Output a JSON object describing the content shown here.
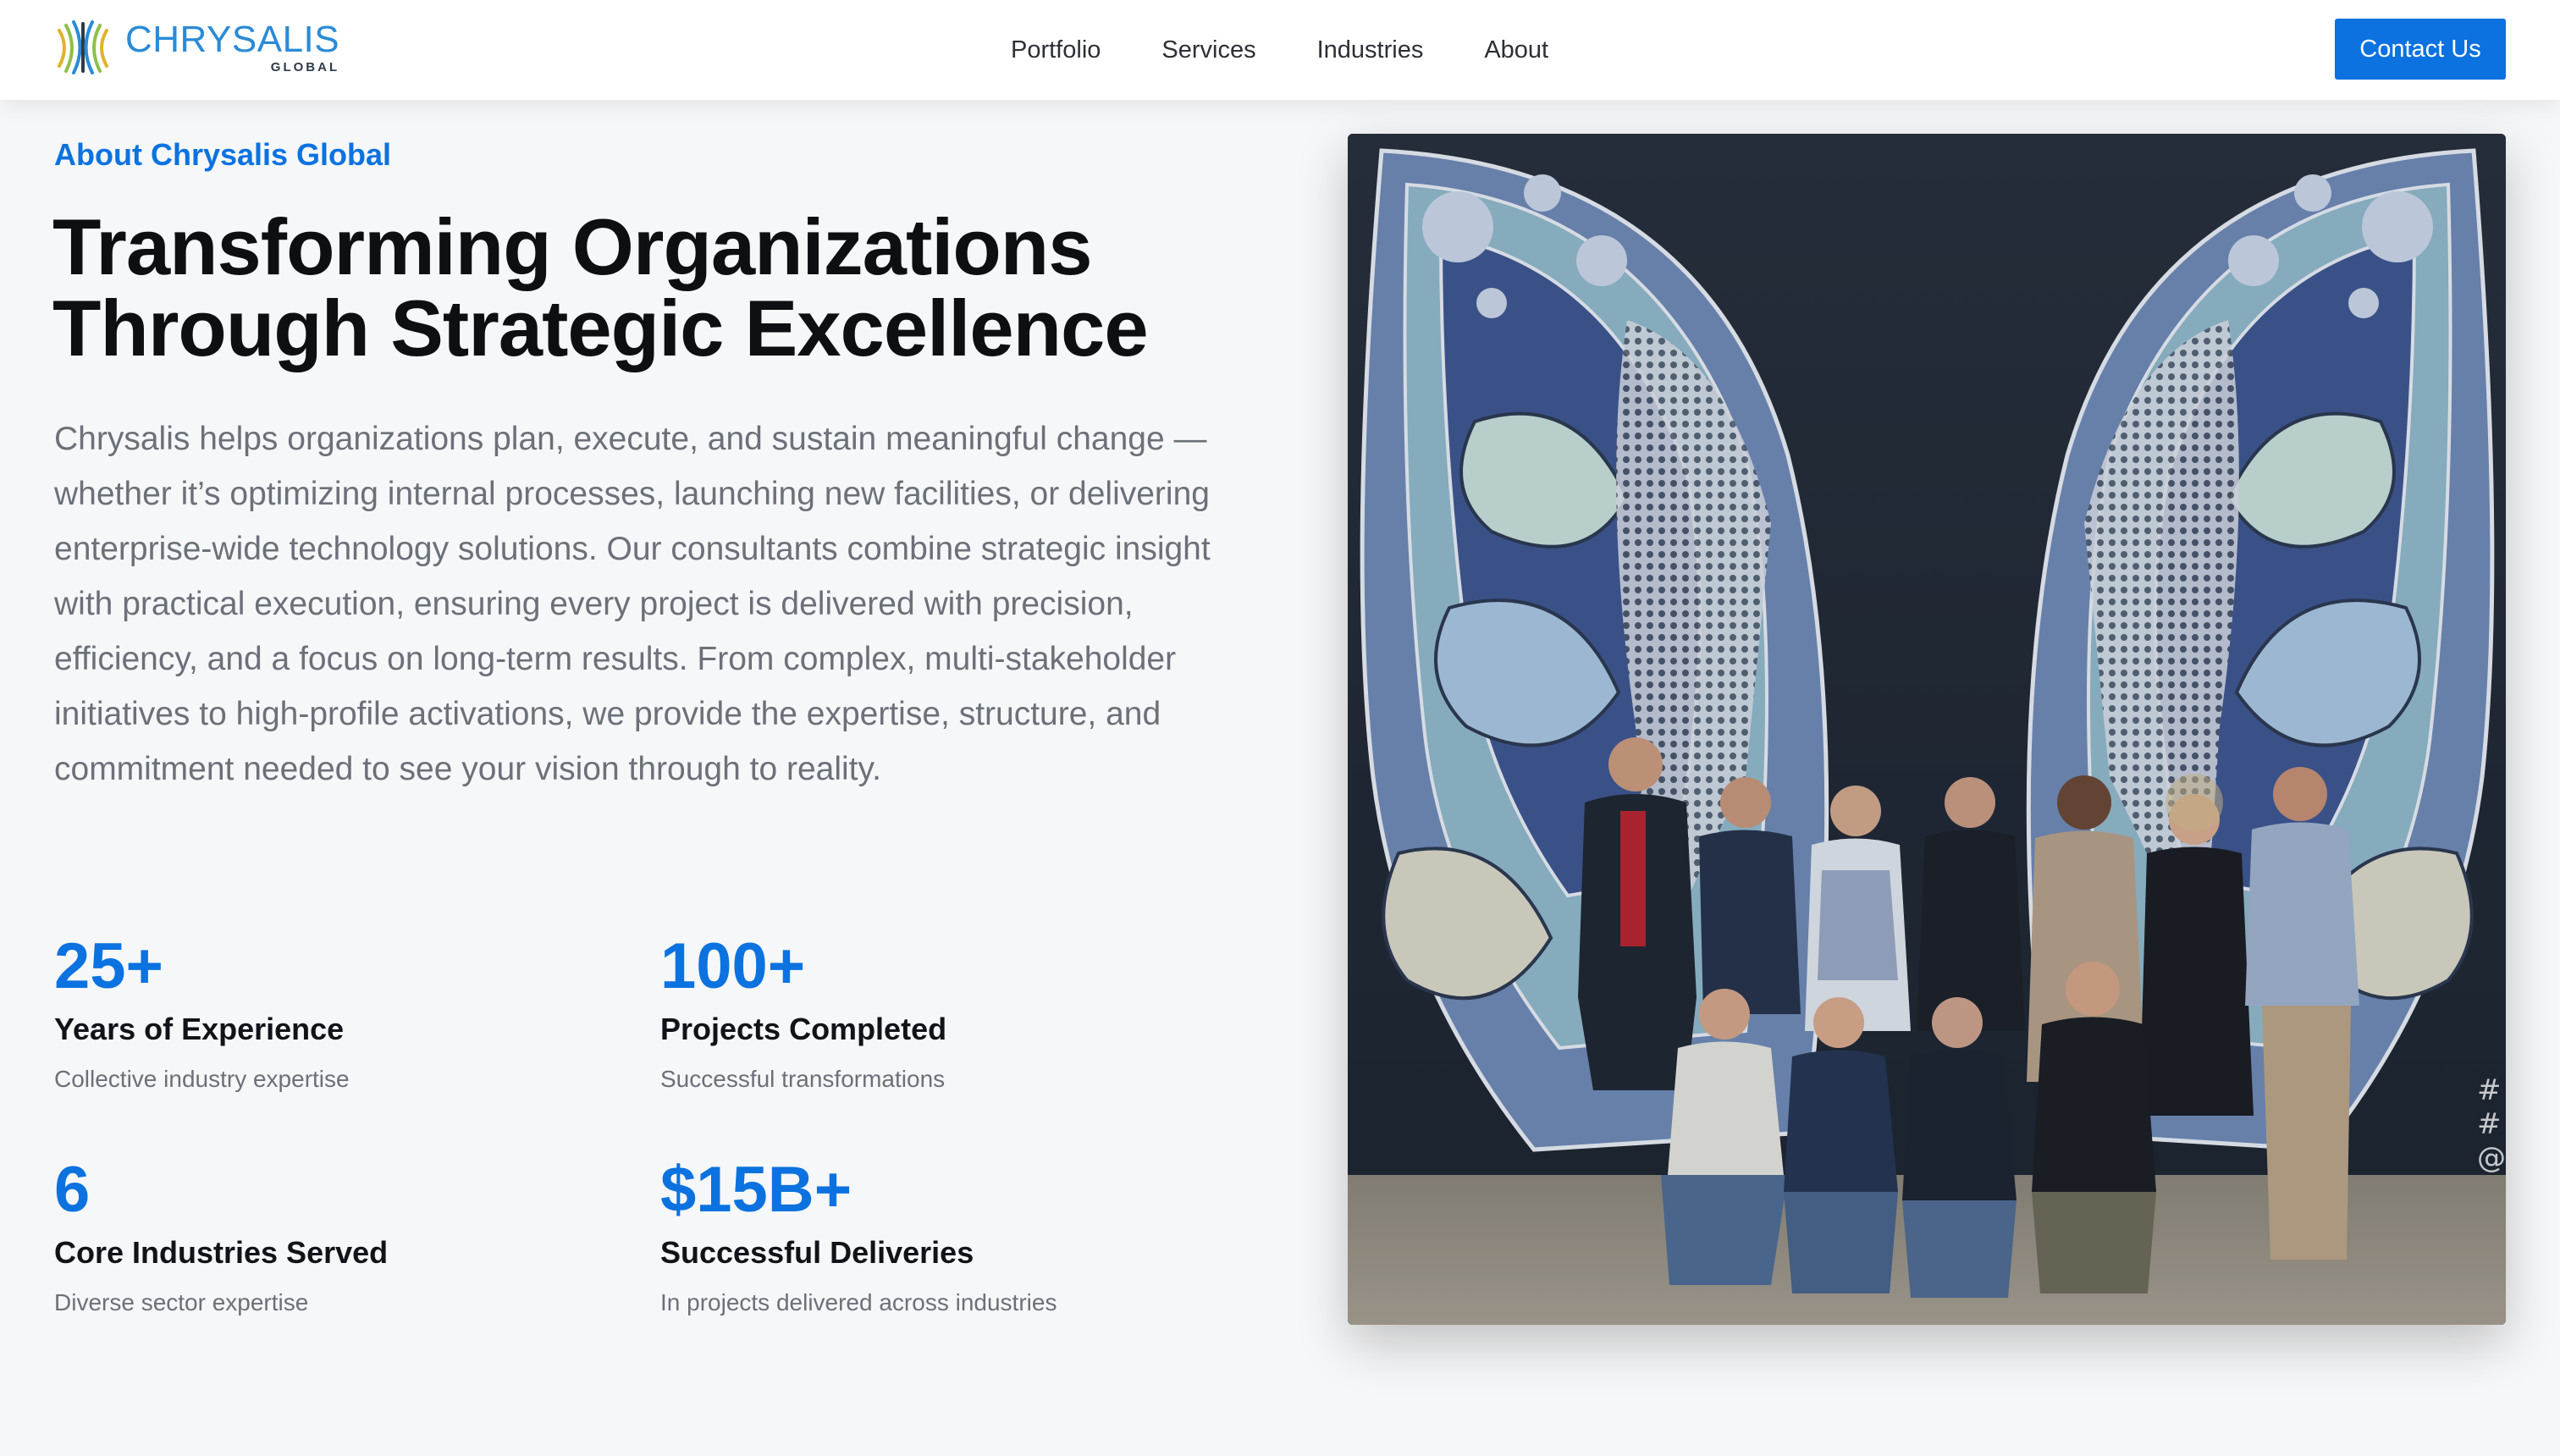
{
  "brand": {
    "name": "CHRYSALIS",
    "sub": "GLOBAL",
    "accent": "#0b72e0",
    "logo_blue": "#2b8bd6"
  },
  "nav": {
    "links": [
      "Portfolio",
      "Services",
      "Industries",
      "About"
    ],
    "cta": "Contact Us"
  },
  "about": {
    "eyebrow": "About Chrysalis Global",
    "headline_line1": "Transforming Organizations",
    "headline_line2": "Through Strategic Excellence",
    "intro": "Chrysalis helps organizations plan, execute, and sustain meaningful change — whether it’s optimizing internal processes, launching new facilities, or delivering enterprise-wide technology solutions. Our consultants combine strategic insight with practical execution, ensuring every project is delivered with precision, efficiency, and a focus on long-term results. From complex, multi-stakeholder initiatives to high-profile activations, we provide the expertise, structure, and commitment needed to see your vision through to reality."
  },
  "stats": [
    {
      "value": "25+",
      "label": "Years of Experience",
      "desc": "Collective industry expertise"
    },
    {
      "value": "100+",
      "label": "Projects Completed",
      "desc": "Successful transformations"
    },
    {
      "value": "6",
      "label": "Core Industries Served",
      "desc": "Diverse sector expertise"
    },
    {
      "value": "$15B+",
      "label": "Successful Deliveries",
      "desc": "In projects delivered across industries"
    }
  ],
  "photo": {
    "overlay_text": "#\n#\n@"
  }
}
